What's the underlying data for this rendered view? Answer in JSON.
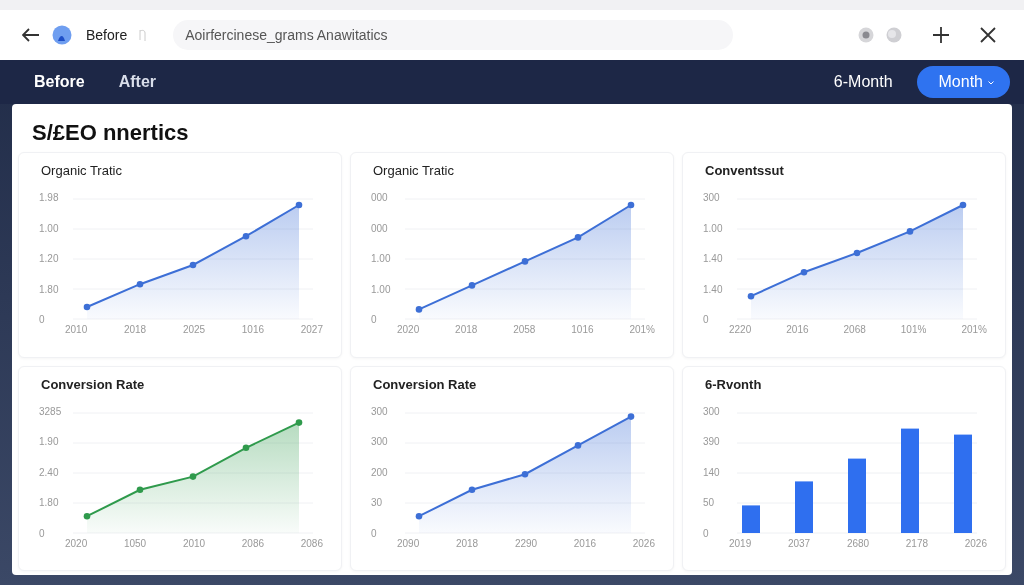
{
  "browser": {
    "tab_label": "Before",
    "address": "Aoirfercinese_grams Anawitatics"
  },
  "nav": {
    "tabs": [
      {
        "label": "Before",
        "selected": true
      },
      {
        "label": "After",
        "selected": false
      }
    ],
    "periods": [
      {
        "label": "6-Month",
        "selected": false
      },
      {
        "label": "Month",
        "selected": true
      }
    ]
  },
  "dashboard": {
    "title": "S/£EO nnertics",
    "panels": [
      {
        "title": "Organic Tratic",
        "bold": false,
        "kind": "area",
        "color": "#3d6fd6",
        "y_labels": [
          "1.98",
          "1.00",
          "1.20",
          "1.80",
          "0"
        ],
        "x_labels": [
          "2010",
          "2018",
          "2025",
          "1016",
          "2027"
        ]
      },
      {
        "title": "Organic Tratic",
        "bold": false,
        "kind": "area",
        "color": "#3d6fd6",
        "y_labels": [
          "000",
          "000",
          "1.00",
          "1.00",
          "0"
        ],
        "x_labels": [
          "2020",
          "2018",
          "2058",
          "1016",
          "201%"
        ]
      },
      {
        "title": "Conventssut",
        "bold": true,
        "kind": "area",
        "color": "#3d6fd6",
        "y_labels": [
          "300",
          "1.00",
          "1.40",
          "1.40",
          "0"
        ],
        "x_labels": [
          "2220",
          "2016",
          "2068",
          "101%",
          "201%"
        ]
      },
      {
        "title": "Conversion Rate",
        "bold": true,
        "kind": "area",
        "color": "#2f9a4c",
        "y_labels": [
          "3285",
          "1.90",
          "2.40",
          "1.80",
          "0"
        ],
        "x_labels": [
          "2020",
          "1050",
          "2010",
          "2086",
          "2086"
        ]
      },
      {
        "title": "Conversion Rate",
        "bold": true,
        "kind": "area",
        "color": "#3d6fd6",
        "y_labels": [
          "300",
          "300",
          "200",
          "30",
          "0"
        ],
        "x_labels": [
          "2090",
          "2018",
          "2290",
          "2016",
          "2026"
        ]
      },
      {
        "title": "6-Rvonth",
        "bold": true,
        "kind": "bar",
        "color": "#2f6fef",
        "y_labels": [
          "300",
          "390",
          "140",
          "50",
          "0"
        ],
        "x_labels": [
          "2019",
          "2037",
          "2680",
          "2178",
          "2026"
        ]
      }
    ]
  }
}
